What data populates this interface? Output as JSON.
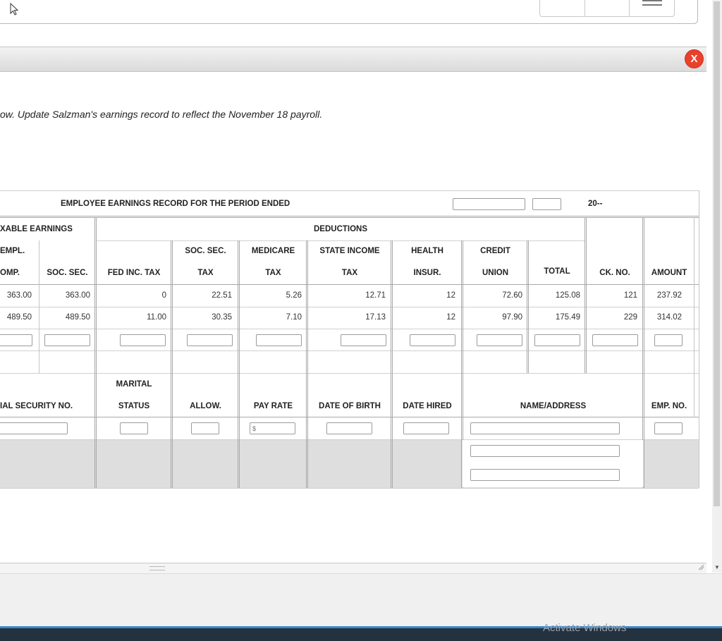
{
  "instructions": "ow. Update Salzman's earnings record to reflect the November 18 payroll.",
  "close_label": "X",
  "watermark": "Activate Windows",
  "record": {
    "title": "EMPLOYEE EARNINGS RECORD FOR THE PERIOD ENDED",
    "year_suffix": "20--",
    "taxable_group": "XABLE EARNINGS",
    "deductions_group": "DEDUCTIONS",
    "columns": {
      "empl_comp": [
        "EMPL.",
        "OMP."
      ],
      "soc_sec": "SOC. SEC.",
      "fed_inc_tax": "FED INC. TAX",
      "soc_sec_tax": [
        "SOC. SEC.",
        "TAX"
      ],
      "medicare_tax": [
        "MEDICARE",
        "TAX"
      ],
      "state_income_tax": [
        "STATE INCOME",
        "TAX"
      ],
      "health_insur": [
        "HEALTH",
        "INSUR."
      ],
      "credit_union": [
        "CREDIT",
        "UNION"
      ],
      "total": "TOTAL",
      "ck_no": "CK. NO.",
      "amount": "AMOUNT"
    },
    "rows": [
      [
        "363.00",
        "363.00",
        "0",
        "22.51",
        "5.26",
        "12.71",
        "12",
        "72.60",
        "125.08",
        "121",
        "237.92"
      ],
      [
        "489.50",
        "489.50",
        "11.00",
        "30.35",
        "7.10",
        "17.13",
        "12",
        "97.90",
        "175.49",
        "229",
        "314.02"
      ]
    ]
  },
  "info": {
    "social_security": "IAL SECURITY NO.",
    "marital": [
      "MARITAL",
      "STATUS"
    ],
    "allow": "ALLOW.",
    "pay_rate": "PAY RATE",
    "pay_rate_placeholder": "$",
    "date_of_birth": "DATE OF BIRTH",
    "date_hired": "DATE HIRED",
    "name_address": "NAME/ADDRESS",
    "emp_no": "EMP. NO."
  }
}
